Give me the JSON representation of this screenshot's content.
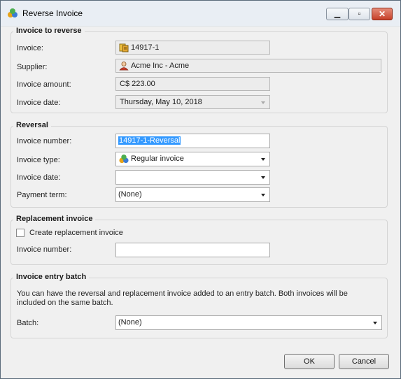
{
  "window": {
    "title": "Reverse Invoice"
  },
  "groups": {
    "to_reverse": {
      "title": "Invoice to reverse",
      "invoice_label": "Invoice:",
      "invoice_value": "14917-1",
      "supplier_label": "Supplier:",
      "supplier_value": "Acme Inc - Acme",
      "amount_label": "Invoice amount:",
      "amount_value": "C$ 223.00",
      "date_label": "Invoice date:",
      "date_value": "Thursday, May 10, 2018"
    },
    "reversal": {
      "title": "Reversal",
      "number_label": "Invoice number:",
      "number_value": "14917-1-Reversal",
      "type_label": "Invoice type:",
      "type_value": "Regular invoice",
      "date_label": "Invoice date:",
      "date_value": "",
      "term_label": "Payment term:",
      "term_value": "(None)"
    },
    "replacement": {
      "title": "Replacement invoice",
      "checkbox_label": "Create replacement invoice",
      "checkbox_checked": false,
      "number_label": "Invoice number:",
      "number_value": ""
    },
    "batch": {
      "title": "Invoice entry batch",
      "description": "You can have the reversal and replacement invoice added to an entry batch.    Both invoices will be included on the same batch.",
      "batch_label": "Batch:",
      "batch_value": "(None)"
    }
  },
  "buttons": {
    "ok": "OK",
    "cancel": "Cancel"
  },
  "icons": {
    "app": "colored-spheres-icon",
    "invoice": "invoice-icon",
    "supplier": "person-icon",
    "invoice_type": "colored-spheres-icon"
  }
}
